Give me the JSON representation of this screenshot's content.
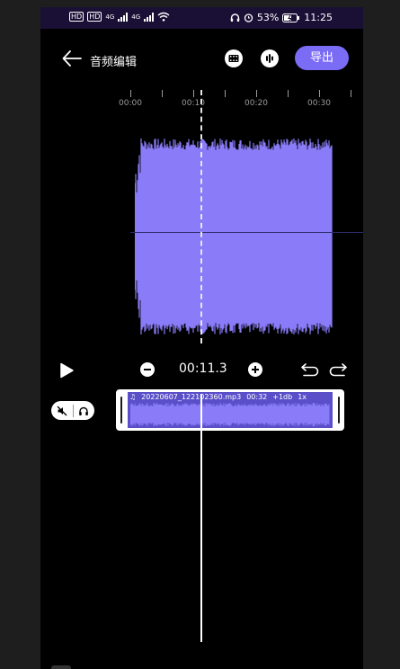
{
  "status": {
    "left_chips": [
      "HD",
      "HD"
    ],
    "sig1": "4G",
    "sig2": "4G",
    "battery_pct": "53%",
    "time": "11:25"
  },
  "header": {
    "title": "音频编辑",
    "export_label": "导出"
  },
  "ruler": {
    "labels": [
      "00:00",
      "00:10",
      "00:20",
      "00:30"
    ]
  },
  "controls": {
    "time": "00:11.3"
  },
  "clip": {
    "filename": "20220607_122102360.mp3",
    "duration": "00:32",
    "gain": "+1db",
    "speed": "1x"
  },
  "colors": {
    "accent": "#7b6cf6",
    "wave": "#8a7cf8",
    "statusbar": "#1a1036"
  },
  "icons": {
    "back": "arrow-left-icon",
    "tool1": "film-strip-icon",
    "tool2": "audio-bars-icon",
    "play": "play-icon",
    "mute": "speaker-muted-icon",
    "monitor": "headphones-icon"
  }
}
